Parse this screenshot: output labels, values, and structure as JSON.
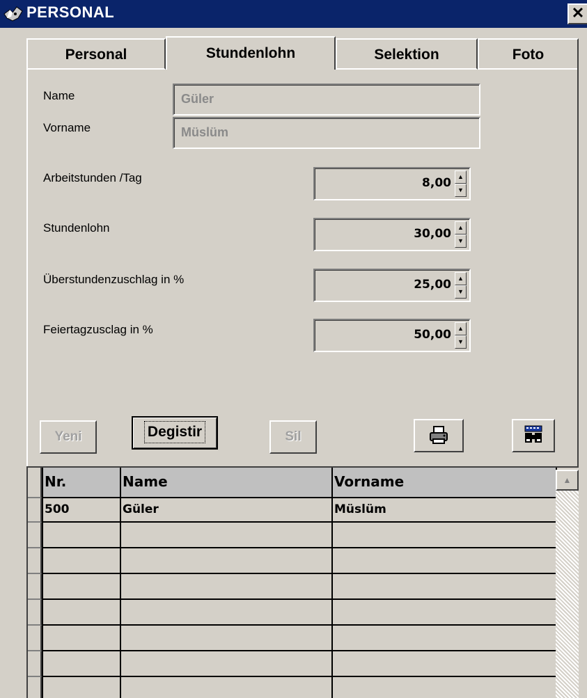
{
  "window": {
    "title": "PERSONAL",
    "close_symbol": "✕"
  },
  "tabs": [
    {
      "label": "Personal",
      "active": false
    },
    {
      "label": "Stundenlohn",
      "active": true
    },
    {
      "label": "Selektion",
      "active": false
    },
    {
      "label": "Foto",
      "active": false
    }
  ],
  "form": {
    "name_label": "Name",
    "name_value": "Güler",
    "vorname_label": "Vorname",
    "vorname_value": "Müslüm",
    "fields": [
      {
        "label": "Arbeitstunden /Tag",
        "value": "8,00"
      },
      {
        "label": "Stundenlohn",
        "value": "30,00"
      },
      {
        "label": "Überstundenzuschlag in %",
        "value": "25,00"
      },
      {
        "label": "Feiertagzusclag in %",
        "value": "50,00"
      }
    ],
    "spin_up": "▲",
    "spin_down": "▼"
  },
  "buttons": {
    "new": "Yeni",
    "edit": "Degistir",
    "delete": "Sil",
    "print_icon": "printer-icon",
    "search_icon": "binoculars-icon"
  },
  "grid": {
    "columns": [
      "Nr.",
      "Name",
      "Vorname"
    ],
    "rows": [
      [
        "500",
        "Güler",
        "Müslüm"
      ]
    ],
    "scroll_up": "▲"
  },
  "colors": {
    "face": "#d4d0c8",
    "title_bar": "#0a246a",
    "disabled_text": "#8a8a8a"
  }
}
